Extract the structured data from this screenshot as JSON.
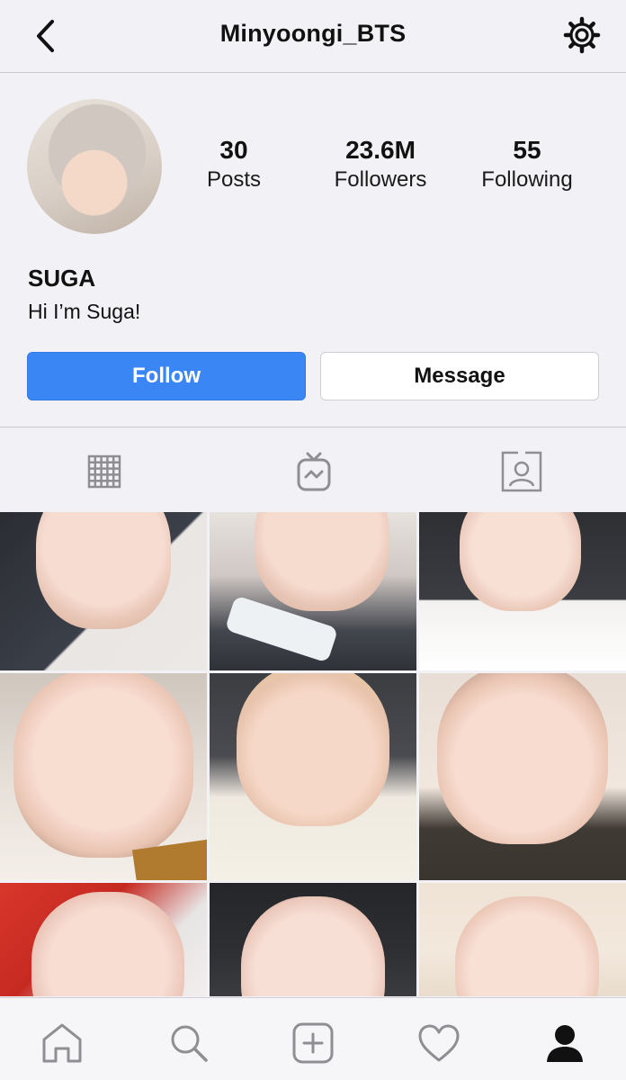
{
  "header": {
    "username": "Minyoongi_BTS"
  },
  "profile": {
    "stats": [
      {
        "value": "30",
        "label": "Posts"
      },
      {
        "value": "23.6M",
        "label": "Followers"
      },
      {
        "value": "55",
        "label": "Following"
      }
    ],
    "display_name": "SUGA",
    "bio": "Hi I’m Suga!"
  },
  "actions": {
    "follow_label": "Follow",
    "message_label": "Message"
  },
  "tabs": [
    {
      "icon": "grid-icon",
      "selected": true
    },
    {
      "icon": "igtv-icon",
      "selected": false
    },
    {
      "icon": "tagged-icon",
      "selected": false
    }
  ],
  "grid": {
    "post_count_visible": 9
  },
  "bottom_nav": [
    {
      "icon": "home-icon"
    },
    {
      "icon": "search-icon"
    },
    {
      "icon": "add-post-icon"
    },
    {
      "icon": "heart-icon"
    },
    {
      "icon": "profile-icon",
      "active": true
    }
  ],
  "colors": {
    "accent": "#3b86f5",
    "background": "#f2f2f6",
    "icon_gray": "#8e8e93"
  }
}
